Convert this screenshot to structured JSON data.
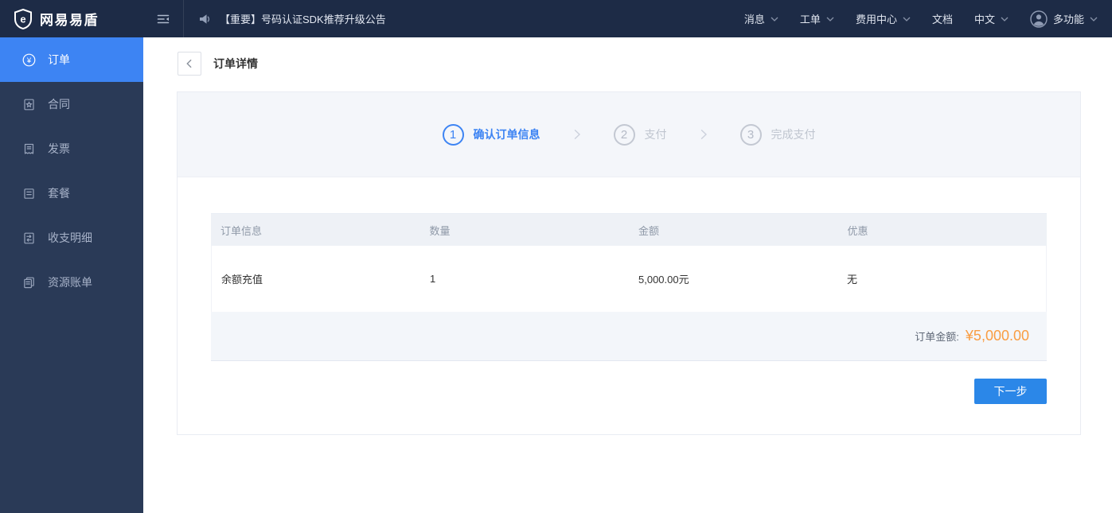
{
  "topbar": {
    "logo_text": "网易易盾",
    "announcement": "【重要】号码认证SDK推荐升级公告",
    "nav": [
      {
        "label": "消息"
      },
      {
        "label": "工单"
      },
      {
        "label": "费用中心"
      },
      {
        "label": "文档"
      },
      {
        "label": "中文"
      }
    ],
    "user_menu": {
      "label": "多功能"
    }
  },
  "sidebar": {
    "items": [
      {
        "label": "订单",
        "icon": "order-yen-icon",
        "active": true
      },
      {
        "label": "合同",
        "icon": "contract-icon",
        "active": false
      },
      {
        "label": "发票",
        "icon": "invoice-icon",
        "active": false
      },
      {
        "label": "套餐",
        "icon": "package-icon",
        "active": false
      },
      {
        "label": "收支明细",
        "icon": "transactions-icon",
        "active": false
      },
      {
        "label": "资源账单",
        "icon": "resource-bill-icon",
        "active": false
      }
    ]
  },
  "page": {
    "title": "订单详情",
    "steps": [
      {
        "num": "1",
        "label": "确认订单信息",
        "state": "active"
      },
      {
        "num": "2",
        "label": "支付",
        "state": "pending"
      },
      {
        "num": "3",
        "label": "完成支付",
        "state": "pending"
      }
    ],
    "table": {
      "headers": [
        "订单信息",
        "数量",
        "金额",
        "优惠"
      ],
      "rows": [
        [
          "余额充值",
          "1",
          "5,000.00元",
          "无"
        ]
      ],
      "total_label": "订单金额:",
      "total_value": "¥5,000.00"
    },
    "next_button": "下一步"
  },
  "colors": {
    "topbar_bg": "#1d2b46",
    "sidebar_bg": "#2a3a57",
    "active_item_bg": "#3d84f3",
    "accent_blue": "#3d84f3",
    "button_blue": "#2b87e8",
    "amount_orange": "#f99d42",
    "table_header_bg": "#eef1f6",
    "card_header_bg": "#f4f6fa"
  }
}
